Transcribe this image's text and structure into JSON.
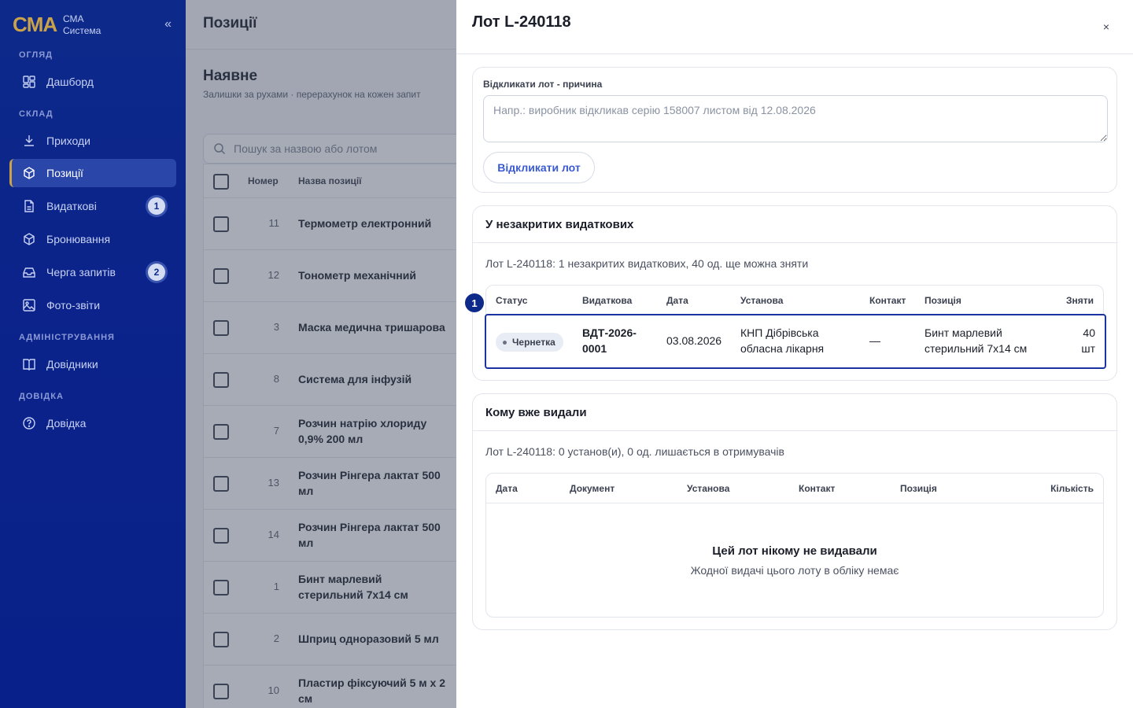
{
  "sidebar": {
    "logo_mark": "CMA",
    "logo_line1": "СМА",
    "logo_line2": "Система",
    "collapse_icon": "«",
    "sections": [
      "ОГЛЯД",
      "СКЛАД",
      "АДМІНІСТРУВАННЯ",
      "ДОВІДКА"
    ],
    "items": [
      {
        "label": "Дашборд",
        "icon": "dashboard-icon"
      },
      {
        "label": "Приходи",
        "icon": "download-icon"
      },
      {
        "label": "Позиції",
        "icon": "box-icon",
        "active": true
      },
      {
        "label": "Видаткові",
        "icon": "document-icon",
        "badge": "1"
      },
      {
        "label": "Бронювання",
        "icon": "box-icon"
      },
      {
        "label": "Черга запитів",
        "icon": "inbox-icon",
        "badge": "2"
      },
      {
        "label": "Фото-звіти",
        "icon": "image-icon"
      },
      {
        "label": "Довідники",
        "icon": "book-icon"
      },
      {
        "label": "Довідка",
        "icon": "help-icon"
      }
    ]
  },
  "main": {
    "topbar_title": "Позиції",
    "heading": "Наявне",
    "subheading": "Залишки за рухами · перерахунок на кожен запит",
    "search_placeholder": "Пошук за назвою або лотом",
    "columns": [
      "Номер",
      "Назва позиції"
    ],
    "rows": [
      {
        "num": "11",
        "name": "Термометр електронний"
      },
      {
        "num": "12",
        "name": "Тонометр механічний"
      },
      {
        "num": "3",
        "name": "Маска медична тришарова"
      },
      {
        "num": "8",
        "name": "Система для інфузій"
      },
      {
        "num": "7",
        "name": "Розчин натрію хлориду 0,9% 200 мл"
      },
      {
        "num": "13",
        "name": "Розчин Рінгера лактат 500 мл"
      },
      {
        "num": "14",
        "name": "Розчин Рінгера лактат 500 мл"
      },
      {
        "num": "1",
        "name": "Бинт марлевий стерильний 7х14 см"
      },
      {
        "num": "2",
        "name": "Шприц одноразовий 5 мл"
      },
      {
        "num": "10",
        "name": "Пластир фіксуючий 5 м х 2 см"
      }
    ]
  },
  "drawer": {
    "title": "Лот L-240118",
    "close": "×",
    "recall": {
      "label": "Відкликати лот - причина",
      "placeholder": "Напр.: виробник відкликав серію 158007 листом від 12.08.2026",
      "button": "Відкликати лот"
    },
    "open_orders": {
      "title": "У незакритих видаткових",
      "summary": "Лот L-240118: 1 незакритих видаткових, 40 од. ще можна зняти",
      "columns": [
        "Статус",
        "Видаткова",
        "Дата",
        "Установа",
        "Контакт",
        "Позиція",
        "Зняти"
      ],
      "row": {
        "marker": "1",
        "status": "Чернетка",
        "doc": "ВДТ-2026-0001",
        "date": "03.08.2026",
        "institution": "КНП Дібрівська обласна лікарня",
        "contact": "—",
        "item": "Бинт марлевий стерильний 7х14 см",
        "qty": "40 шт"
      }
    },
    "issued": {
      "title": "Кому вже видали",
      "summary": "Лот L-240118: 0 установ(и), 0 од. лишається в отримувачів",
      "columns": [
        "Дата",
        "Документ",
        "Установа",
        "Контакт",
        "Позиція",
        "Кількість"
      ],
      "empty_title": "Цей лот нікому не видавали",
      "empty_sub": "Жодної видачі цього лоту в обліку немає"
    }
  }
}
